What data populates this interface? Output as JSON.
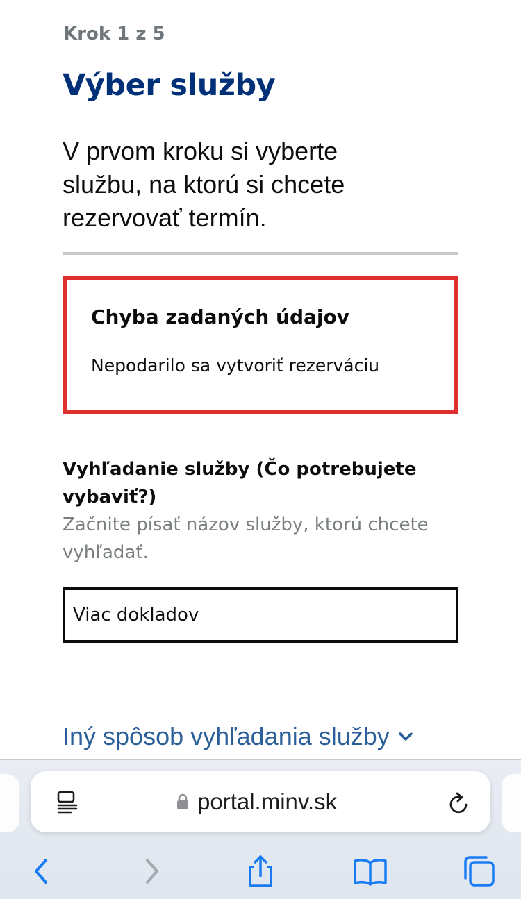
{
  "step": "Krok 1 z 5",
  "title": "Výber služby",
  "lead": "V prvom kroku si vyberte službu, na ktorú si chcete rezervovať termín.",
  "error": {
    "title": "Chyba zadaných údajov",
    "message": "Nepodarilo sa vytvoriť rezerváciu"
  },
  "search": {
    "label": "Vyhľadanie služby (Čo potrebujete vybaviť?)",
    "hint": "Začnite písať názov služby, ktorú chcete vyhľadať.",
    "value": "Viac dokladov"
  },
  "other_link": "Iný spôsob vyhľadania služby",
  "browser": {
    "url": "portal.minv.sk",
    "icons": [
      "reader-icon",
      "lock-icon",
      "reload-icon",
      "back-icon",
      "forward-icon",
      "share-icon",
      "bookmarks-icon",
      "tabs-icon"
    ]
  },
  "colors": {
    "title": "#003078",
    "link": "#2b5f99",
    "error_border": "#df2f2f",
    "toolbar_icon": "#1a7cf5"
  }
}
